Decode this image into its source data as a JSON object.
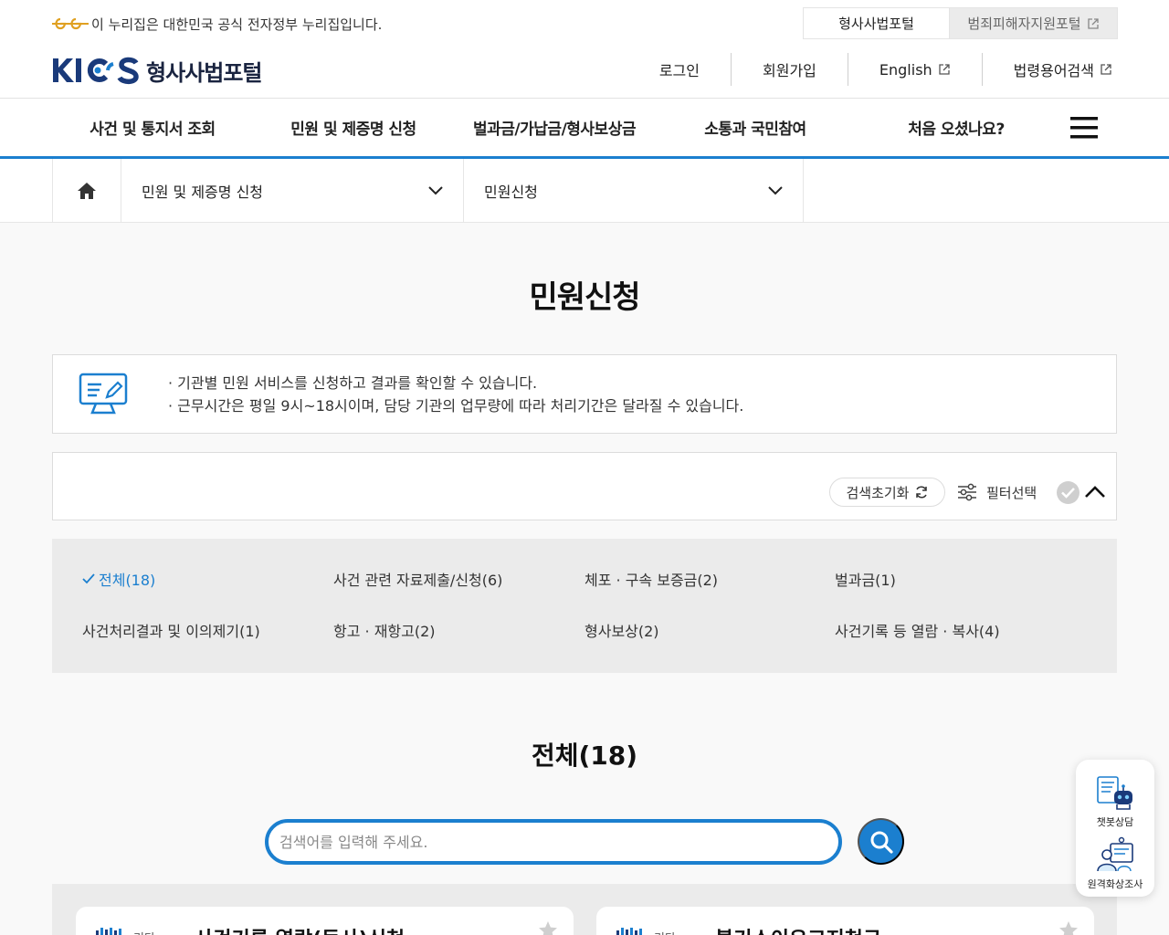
{
  "header": {
    "gov_notice": "이 누리집은 대한민국 공식 전자정부 누리집입니다.",
    "site_tabs": [
      "형사사법포털",
      "범죄피해자지원포털"
    ],
    "logo_mark": "KICS",
    "logo_text": "형사사법포털",
    "utility_links": [
      "로그인",
      "회원가입",
      "English",
      "법령용어검색"
    ]
  },
  "gnb": {
    "items": [
      "사건 및 통지서 조회",
      "민원 및 제증명 신청",
      "벌과금/가납금/형사보상금",
      "소통과 국민참여",
      "처음 오셨나요?"
    ],
    "menu_icon": "hamburger-icon"
  },
  "location": {
    "home_icon": "home-icon",
    "depth1": "민원 및 제증명 신청",
    "depth2": "민원신청"
  },
  "main": {
    "title": "민원신청",
    "info_lines": [
      "· 기관별 민원 서비스를 신청하고 결과를 확인할 수 있습니다.",
      "· 근무시간은 평일 9시~18시이며, 담당 기관의 업무량에 따라 처리기간은 달라질 수 있습니다."
    ],
    "filter": {
      "reset_label": "검색초기화",
      "select_label": "필터선택"
    },
    "categories": [
      "전체(18)",
      "사건 관련 자료제출/신청(6)",
      "체포 · 구속 보증금(2)",
      "벌과금(1)",
      "사건처리결과 및 이의제기(1)",
      "항고 · 재항고(2)",
      "형사보상(2)",
      "사건기록 등 열람 · 복사(4)"
    ],
    "selected_category": "전체(18)",
    "section_title": "전체",
    "section_count": "(18)",
    "search": {
      "placeholder": "검색어를 입력해 주세요.",
      "value": ""
    },
    "cards": [
      {
        "tag": "기타",
        "title": "사건기록 열람(등사)신청"
      },
      {
        "tag": "기타",
        "title": "불기소이유고지청구"
      }
    ]
  },
  "quick_menu": [
    "챗봇상담",
    "원격화상조사"
  ],
  "colors": {
    "accent": "#1b7fcf",
    "brand_navy": "#1a3a7a",
    "panel_gray": "#ebebeb"
  }
}
